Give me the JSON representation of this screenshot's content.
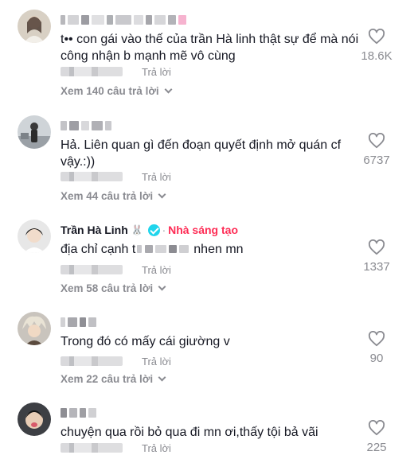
{
  "comments": [
    {
      "username_blurred": true,
      "text": "t•• con gái vào thế của trần Hà linh thật sự để mà nói công nhận b mạnh mẽ vô cùng",
      "reply_label": "Trả lời",
      "view_replies": "Xem 140 câu trả lời",
      "likes": "18.6K"
    },
    {
      "username_blurred": true,
      "text": "Hả. Liên quan gì đến đoạn quyết định mở quán cf vậy.:))",
      "reply_label": "Trả lời",
      "view_replies": "Xem 44 câu trả lời",
      "likes": "6737"
    },
    {
      "username": "Trần Hà Linh",
      "username_emoji": "🐰",
      "badge": "Nhà sáng tạo",
      "text_start": "địa chỉ cạnh t",
      "text_end": "nhen mn",
      "reply_label": "Trả lời",
      "view_replies": "Xem 58 câu trả lời",
      "likes": "1337"
    },
    {
      "username_blurred": true,
      "text": "Trong đó có mấy cái giường v",
      "reply_label": "Trả lời",
      "view_replies": "Xem 22 câu trả lời",
      "likes": "90"
    },
    {
      "username_blurred": true,
      "text": "chuyện qua rồi bỏ qua đi mn ơi,thấy tội bả vãi",
      "reply_label": "Trả lời",
      "likes": "225"
    }
  ],
  "colors": {
    "primary_text": "#161823",
    "secondary_text": "#8a8b91",
    "creator_badge": "#fe2c55",
    "verified": "#20d5ec"
  },
  "icons": [
    "heart-outline-icon",
    "verified-icon",
    "chevron-down-icon"
  ]
}
